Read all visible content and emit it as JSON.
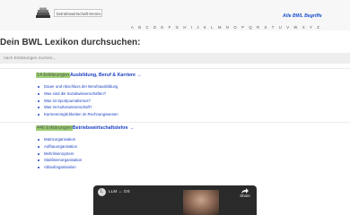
{
  "header": {
    "site_url": "betriebswirtschaft-lernen.net",
    "all_terms_link": "Alle BWL Begriffe",
    "alphabet": [
      "A",
      "B",
      "C",
      "D",
      "E",
      "F",
      "G",
      "H",
      "I",
      "J",
      "K",
      "L",
      "M",
      "N",
      "O",
      "P",
      "Q",
      "R",
      "S",
      "T",
      "U",
      "V",
      "W",
      "X",
      "Y",
      "Z"
    ]
  },
  "main": {
    "title": "Dein BWL Lexikon durchsuchen:",
    "search": {
      "placeholder": "nach Erklärungen suchen...",
      "value": ""
    },
    "categories": [
      {
        "count": "14 Erklärungen",
        "name": "Ausbildung, Beruf & Karriere",
        "arrow": "→",
        "items": [
          "Dauer und Abschluss der Berufsausbildung",
          "Was sind die Sozialwissenschaften?",
          "Was ist Sportjournalismus?",
          "Was ist Kulturwissenschaft?",
          "Karrieremöglichkeiten im Rechnungswesen"
        ]
      },
      {
        "count": "446 Erklärungen",
        "name": "Betriebswirtschaftslehre",
        "arrow": "→",
        "items": [
          "Matrixorganisation",
          "Aufbauorganisation",
          "Mehrliniensystem",
          "Stablinienorganisation",
          "Ablauforganisation"
        ]
      }
    ]
  },
  "video": {
    "channel_initial": "L",
    "title": "LLM ↔ OS",
    "share_label": "Share"
  },
  "colors": {
    "link": "#1a3fc0",
    "count_badge": "#9ccf72",
    "top_bar": "#f7f7f7"
  },
  "icons": [
    "logo-book-icon",
    "share-arrow-icon"
  ]
}
